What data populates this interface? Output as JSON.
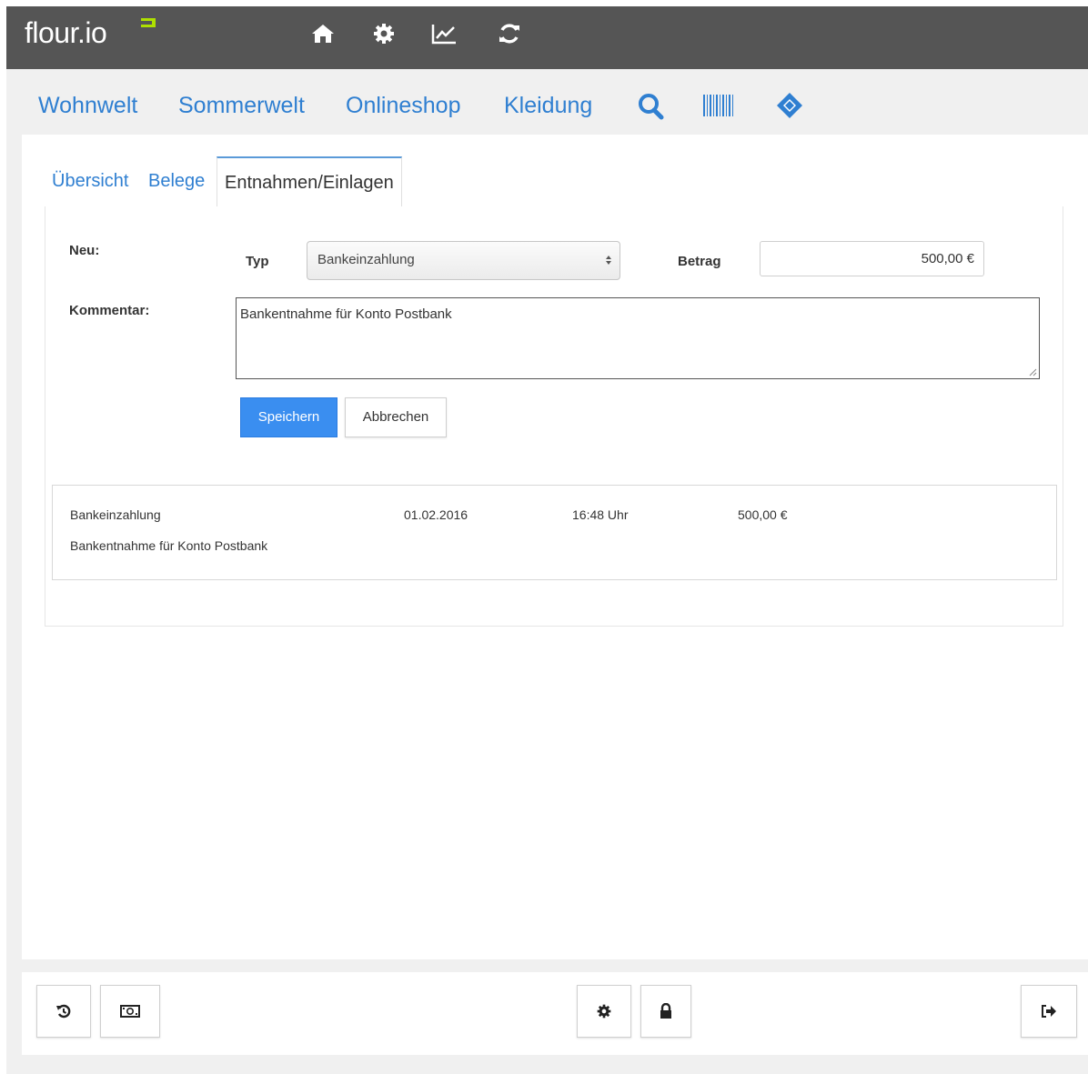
{
  "app": {
    "logo_text": "flour.io",
    "logo_badge_icon": "flour-badge-icon",
    "accent_color": "#2f7fd1",
    "logo_accent_color": "#aee000"
  },
  "topbar": {
    "icons": [
      "home-icon",
      "gear-icon",
      "line-chart-icon",
      "refresh-icon"
    ]
  },
  "subnav": {
    "links": [
      "Wohnwelt",
      "Sommerwelt",
      "Onlineshop",
      "Kleidung"
    ],
    "icons": [
      "search-icon",
      "barcode-icon",
      "ticket-icon"
    ]
  },
  "tabs": {
    "items": [
      "Übersicht",
      "Belege",
      "Entnahmen/Einlagen"
    ],
    "active": "Entnahmen/Einlagen"
  },
  "form": {
    "neu_label": "Neu:",
    "typ_label": "Typ",
    "typ_value": "Bankeinzahlung",
    "betrag_label": "Betrag",
    "betrag_value": "500,00 €",
    "kommentar_label": "Kommentar:",
    "kommentar_value": "Bankentnahme für Konto Postbank",
    "save_label": "Speichern",
    "cancel_label": "Abbrechen",
    "save_color": "#3a8ef0"
  },
  "entries": [
    {
      "type": "Bankeinzahlung",
      "date": "01.02.2016",
      "time": "16:48 Uhr",
      "amount": "500,00 €",
      "comment": "Bankentnahme für Konto Postbank"
    }
  ],
  "footer": {
    "left_icons": [
      "history-icon",
      "cash-icon"
    ],
    "center_icons": [
      "gear-icon",
      "lock-icon"
    ],
    "right_icons": [
      "logout-icon"
    ]
  }
}
